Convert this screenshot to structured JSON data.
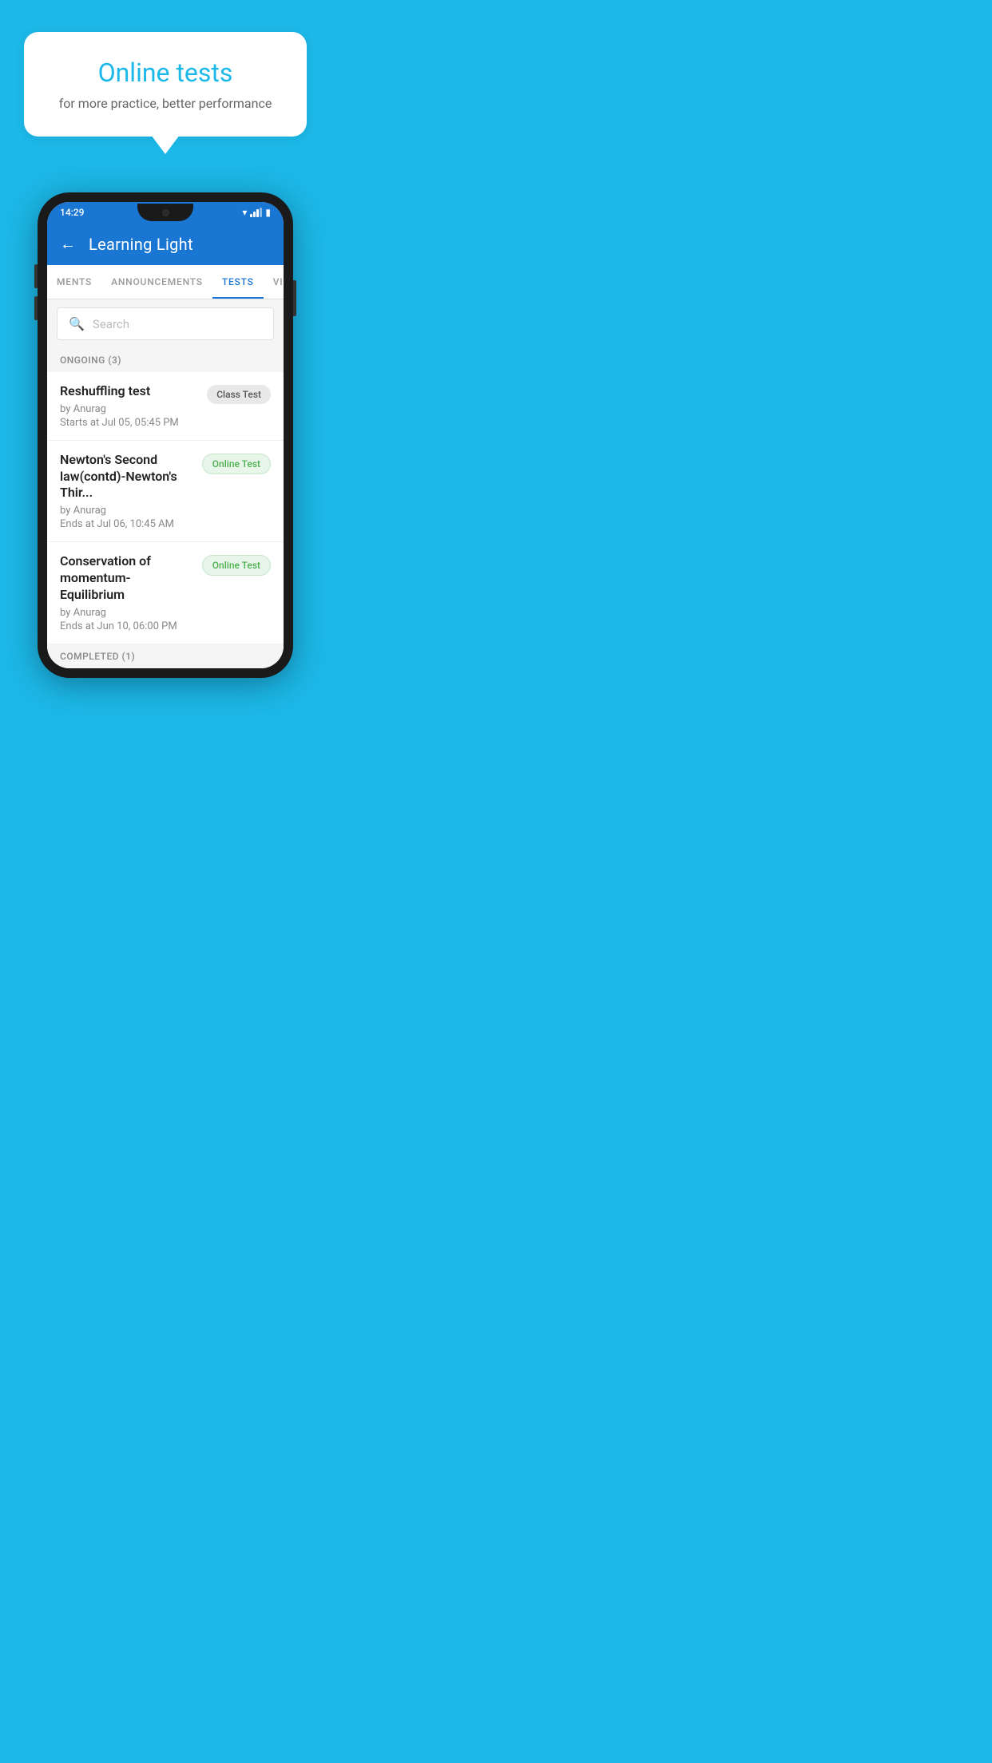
{
  "background_color": "#1CB8E8",
  "promo": {
    "title": "Online tests",
    "subtitle": "for more practice, better performance"
  },
  "phone": {
    "status_bar": {
      "time": "14:29"
    },
    "header": {
      "title": "Learning Light",
      "back_label": "←"
    },
    "tabs": [
      {
        "label": "MENTS",
        "active": false
      },
      {
        "label": "ANNOUNCEMENTS",
        "active": false
      },
      {
        "label": "TESTS",
        "active": true
      },
      {
        "label": "VIDEOS",
        "active": false
      }
    ],
    "search": {
      "placeholder": "Search"
    },
    "ongoing_section": {
      "label": "ONGOING (3)"
    },
    "tests": [
      {
        "name": "Reshuffling test",
        "author": "by Anurag",
        "time_label": "Starts at",
        "time": "Jul 05, 05:45 PM",
        "badge": "Class Test",
        "badge_type": "class"
      },
      {
        "name": "Newton's Second law(contd)-Newton's Thir...",
        "author": "by Anurag",
        "time_label": "Ends at",
        "time": "Jul 06, 10:45 AM",
        "badge": "Online Test",
        "badge_type": "online"
      },
      {
        "name": "Conservation of momentum-Equilibrium",
        "author": "by Anurag",
        "time_label": "Ends at",
        "time": "Jun 10, 06:00 PM",
        "badge": "Online Test",
        "badge_type": "online"
      }
    ],
    "completed_section": {
      "label": "COMPLETED (1)"
    }
  }
}
